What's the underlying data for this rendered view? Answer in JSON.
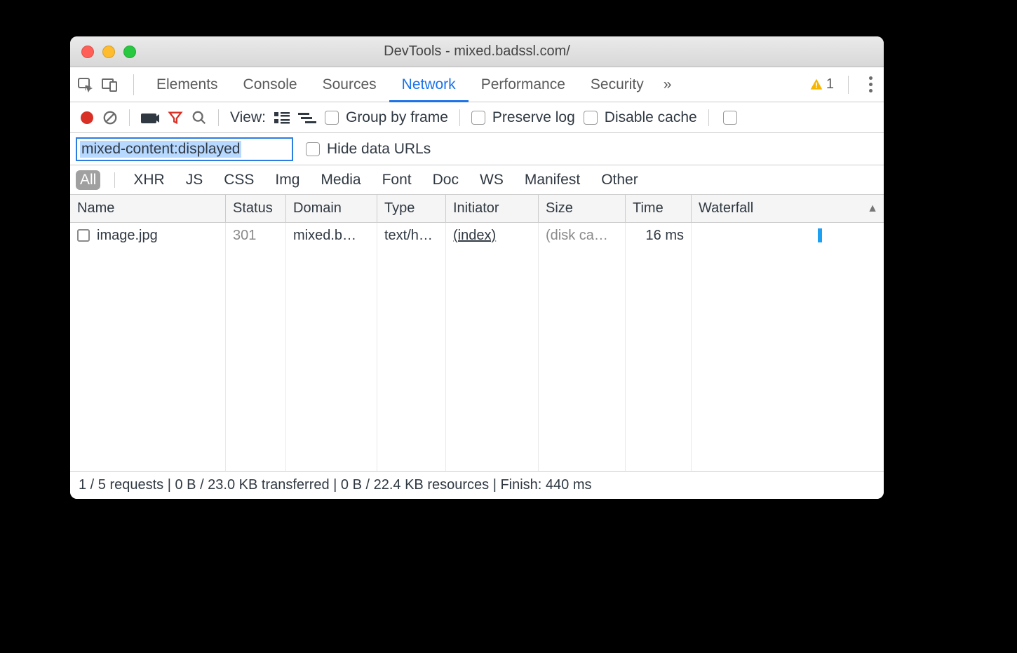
{
  "window": {
    "title": "DevTools - mixed.badssl.com/"
  },
  "tabs": {
    "items": [
      "Elements",
      "Console",
      "Sources",
      "Network",
      "Performance",
      "Security"
    ],
    "active": "Network",
    "warnings_count": "1"
  },
  "toolbar": {
    "view_label": "View:",
    "group_by_frame": "Group by frame",
    "preserve_log": "Preserve log",
    "disable_cache": "Disable cache"
  },
  "filter": {
    "value": "mixed-content:displayed",
    "hide_data_urls": "Hide data URLs"
  },
  "types": {
    "items": [
      "All",
      "XHR",
      "JS",
      "CSS",
      "Img",
      "Media",
      "Font",
      "Doc",
      "WS",
      "Manifest",
      "Other"
    ],
    "active": "All"
  },
  "columns": {
    "name": "Name",
    "status": "Status",
    "domain": "Domain",
    "type": "Type",
    "initiator": "Initiator",
    "size": "Size",
    "time": "Time",
    "waterfall": "Waterfall"
  },
  "rows": [
    {
      "name": "image.jpg",
      "status": "301",
      "domain": "mixed.b…",
      "type": "text/h…",
      "initiator": "(index)",
      "size": "(disk ca…",
      "time": "16 ms"
    }
  ],
  "status": "1 / 5 requests | 0 B / 23.0 KB transferred | 0 B / 22.4 KB resources | Finish: 440 ms"
}
